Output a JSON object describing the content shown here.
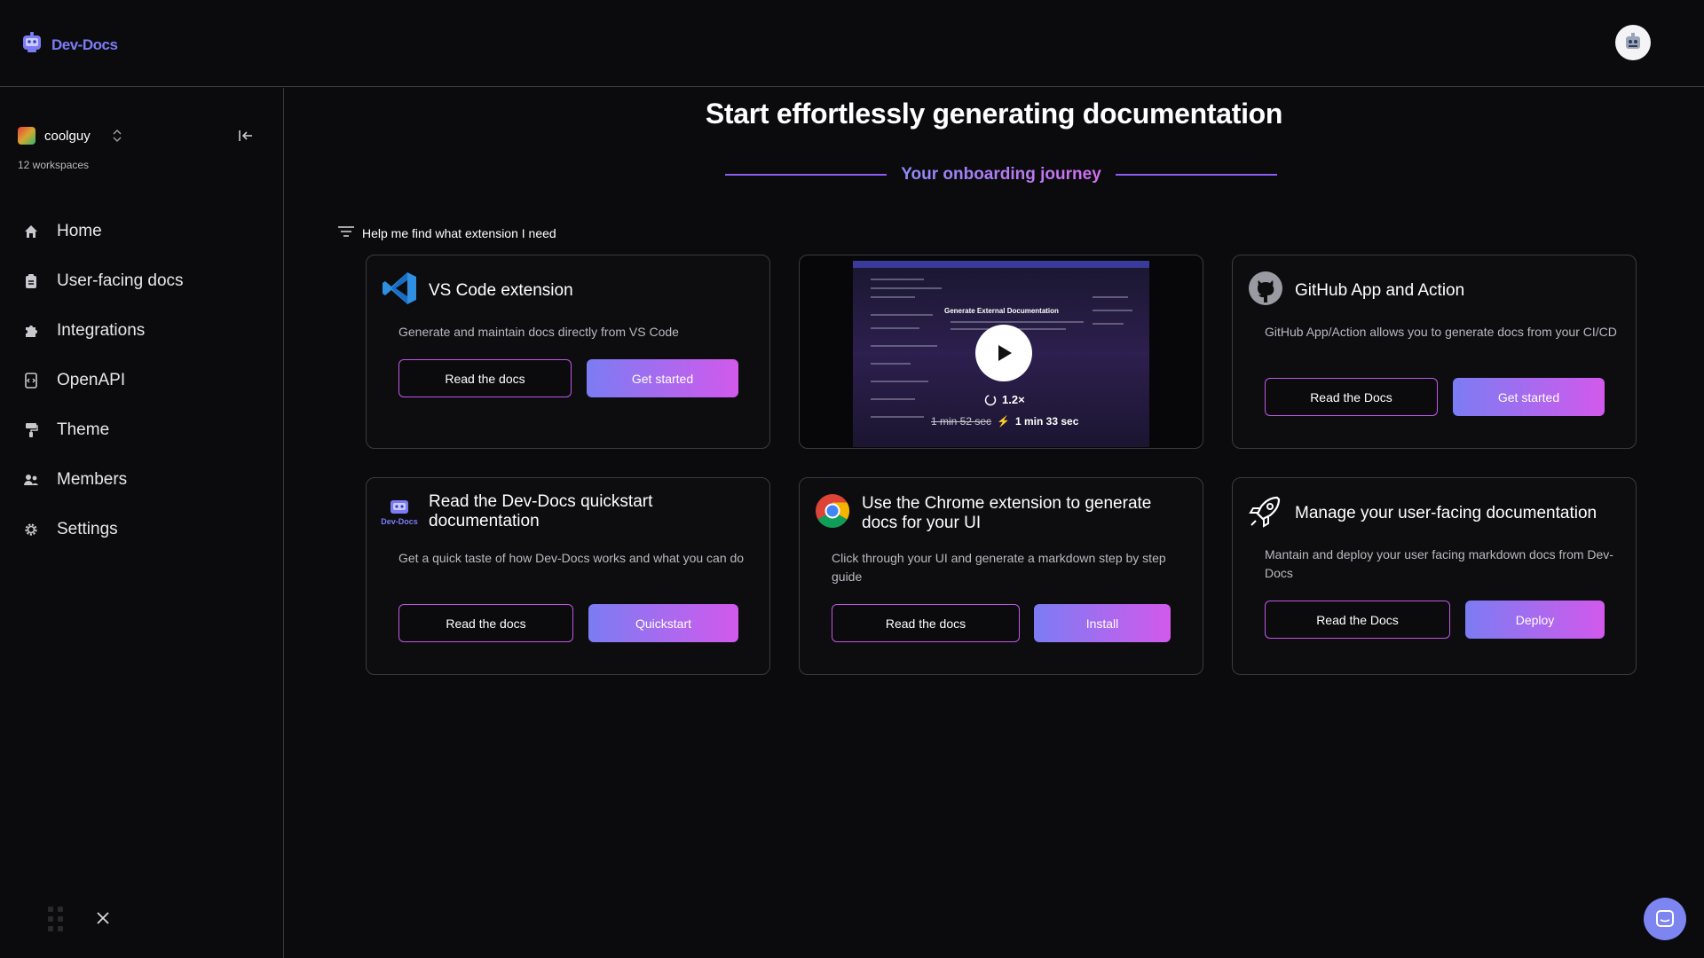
{
  "app": {
    "name": "Dev-Docs"
  },
  "workspace": {
    "name": "coolguy",
    "count_label": "12 workspaces"
  },
  "sidebar": {
    "items": [
      {
        "label": "Home",
        "icon": "home-icon"
      },
      {
        "label": "User-facing docs",
        "icon": "clipboard-icon"
      },
      {
        "label": "Integrations",
        "icon": "puzzle-icon"
      },
      {
        "label": "OpenAPI",
        "icon": "api-doc-icon"
      },
      {
        "label": "Theme",
        "icon": "paint-roller-icon"
      },
      {
        "label": "Members",
        "icon": "members-icon"
      },
      {
        "label": "Settings",
        "icon": "gear-icon"
      }
    ]
  },
  "main": {
    "title": "Start effortlessly generating documentation",
    "journey_label": "Your onboarding journey",
    "help_label": "Help me find what extension I need"
  },
  "cards": {
    "vscode": {
      "title": "VS Code extension",
      "desc": "Generate and maintain docs directly from VS Code",
      "btn1": "Read the docs",
      "btn2": "Get started"
    },
    "video": {
      "heading": "Generate External Documentation",
      "speed": "1.2×",
      "old_time": "1 min 52 sec",
      "new_time": "1 min 33 sec"
    },
    "github": {
      "title": "GitHub App and Action",
      "desc": "GitHub App/Action allows you to generate docs from your CI/CD",
      "btn1": "Read the Docs",
      "btn2": "Get started"
    },
    "quickstart": {
      "title": "Read the Dev-Docs quickstart documentation",
      "desc": "Get a quick taste of how Dev-Docs works and what you can do",
      "btn1": "Read the docs",
      "btn2": "Quickstart",
      "logo_text": "Dev-Docs"
    },
    "chrome": {
      "title": "Use the Chrome extension to generate docs for your UI",
      "desc": "Click through your UI and generate a markdown step by step guide",
      "btn1": "Read the docs",
      "btn2": "Install"
    },
    "manage": {
      "title": "Manage your user-facing documentation",
      "desc": "Mantain and deploy your user facing markdown docs from Dev-Docs",
      "btn1": "Read the Docs",
      "btn2": "Deploy"
    }
  },
  "colors": {
    "accent": "#7b7cf5",
    "gradient_start": "#7c7cf2",
    "gradient_end": "#d259ec",
    "background": "#0b0b0d",
    "border": "#3b3b40"
  }
}
